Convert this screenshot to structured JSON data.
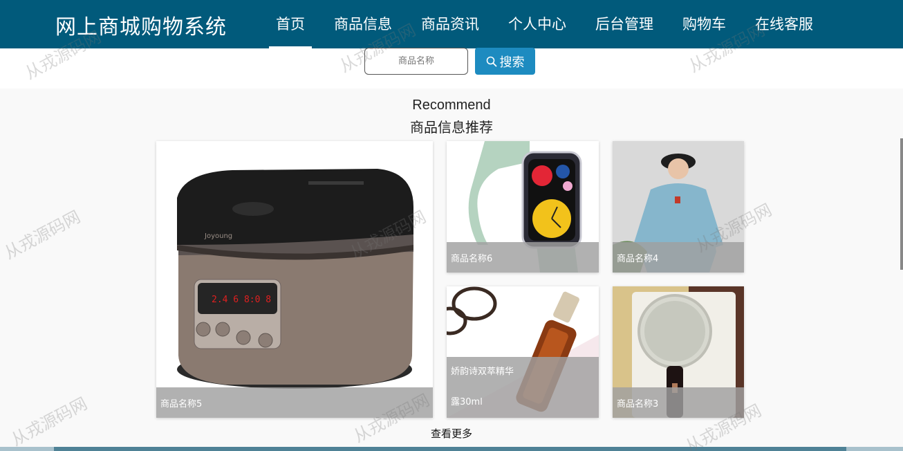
{
  "header": {
    "brand": "网上商城购物系统",
    "nav": [
      {
        "label": "首页",
        "active": true
      },
      {
        "label": "商品信息",
        "active": false
      },
      {
        "label": "商品资讯",
        "active": false
      },
      {
        "label": "个人中心",
        "active": false
      },
      {
        "label": "后台管理",
        "active": false
      },
      {
        "label": "购物车",
        "active": false
      },
      {
        "label": "在线客服",
        "active": false
      }
    ]
  },
  "search": {
    "placeholder": "商品名称",
    "button_label": "搜索",
    "button_icon": "search-icon"
  },
  "section": {
    "title_en": "Recommend",
    "title_cn": "商品信息推荐"
  },
  "products": [
    {
      "name": "商品名称5",
      "image": "rice-cooker"
    },
    {
      "name": "商品名称6",
      "image": "smart-watch"
    },
    {
      "name": "商品名称4",
      "image": "blue-hoodie"
    },
    {
      "name": "娇韵诗双萃精华露30ml",
      "name_line1": "娇韵诗双萃精华",
      "name_line2": "露30ml",
      "image": "serum-bottle"
    },
    {
      "name": "商品名称3",
      "image": "vanity-mirror"
    }
  ],
  "more_label": "查看更多",
  "watermark": "从戎源码网",
  "colors": {
    "header_bg": "#015a7b",
    "search_button": "#1d8bc0",
    "caption_bg": "#a0a0a0"
  }
}
